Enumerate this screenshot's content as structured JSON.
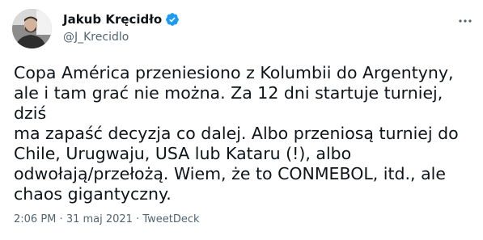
{
  "tweet": {
    "author": {
      "display_name": "Jakub Kręcidło",
      "handle": "@J_Krecidlo",
      "verified": true,
      "avatar_icon": "profile-photo"
    },
    "text": "Copa América przeniesiono z Kolumbii do Argentyny,\nale i tam grać nie można. Za 12 dni startuje turniej, dziś\nma zapaść decyzja co dalej. Albo przeniosą turniej do\nChile, Urugwaju, USA lub Kataru (!), albo\nodwołają/przełożą. Wiem, że to CONMEBOL, itd., ale\nchaos gigantyczny.",
    "meta": {
      "time": "2:06 PM",
      "separator": "·",
      "date": "31 maj 2021",
      "source": "TweetDeck"
    },
    "more_icon": "more-horizontal-icon"
  },
  "colors": {
    "text": "#0f1419",
    "secondary_text": "#536471",
    "verified_badge": "#1d9bf0",
    "background": "#ffffff"
  }
}
